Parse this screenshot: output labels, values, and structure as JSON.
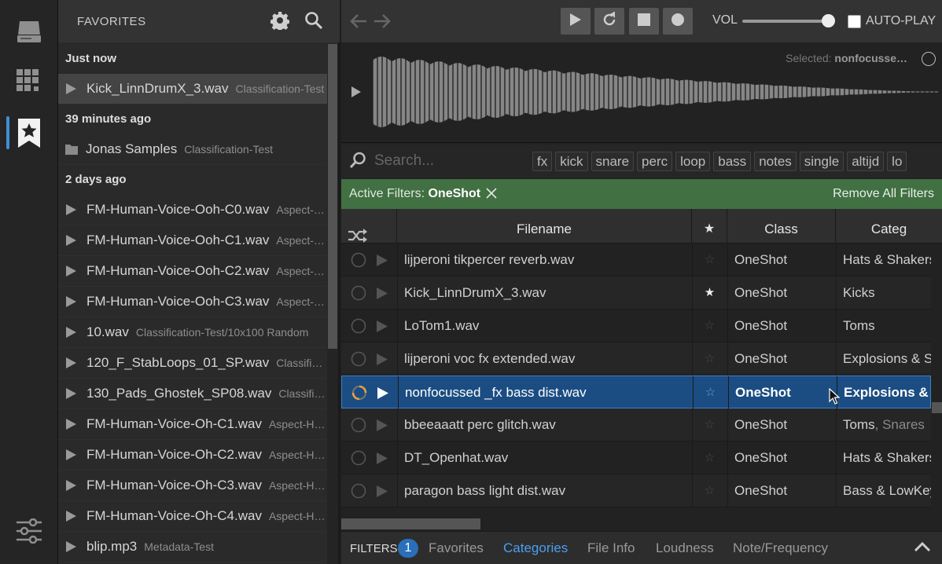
{
  "rail": {
    "items": [
      "drive-icon",
      "grid-icon",
      "star-bookmark-icon",
      "sliders-icon"
    ],
    "active_index": 2,
    "accent": "#3d8fd6"
  },
  "favorites": {
    "title": "FAVORITES",
    "groups": [
      {
        "heading": "Just now",
        "rows": [
          {
            "type": "file",
            "name": "Kick_LinnDrumX_3.wav",
            "sub": "Classification-Test",
            "selected": true
          }
        ]
      },
      {
        "heading": "39 minutes ago",
        "rows": [
          {
            "type": "folder",
            "name": "Jonas Samples",
            "sub": "Classification-Test",
            "selected": false
          }
        ]
      },
      {
        "heading": "2 days ago",
        "rows": [
          {
            "type": "file",
            "name": "FM-Human-Voice-Ooh-C0.wav",
            "sub": "Aspect-Human-Voice",
            "selected": false
          },
          {
            "type": "file",
            "name": "FM-Human-Voice-Ooh-C1.wav",
            "sub": "Aspect-Human-Voice",
            "selected": false
          },
          {
            "type": "file",
            "name": "FM-Human-Voice-Ooh-C2.wav",
            "sub": "Aspect-Human-Voice",
            "selected": false
          },
          {
            "type": "file",
            "name": "FM-Human-Voice-Ooh-C3.wav",
            "sub": "Aspect-Human-Voice",
            "selected": false
          },
          {
            "type": "file",
            "name": "10.wav",
            "sub": "Classification-Test/10x100 Random",
            "selected": false
          },
          {
            "type": "file",
            "name": "120_F_StabLoops_01_SP.wav",
            "sub": "Classification-Test",
            "selected": false
          },
          {
            "type": "file",
            "name": "130_Pads_Ghostek_SP08.wav",
            "sub": "Classification-Test",
            "selected": false
          },
          {
            "type": "file",
            "name": "FM-Human-Voice-Oh-C1.wav",
            "sub": "Aspect-Human-Voice",
            "selected": false
          },
          {
            "type": "file",
            "name": "FM-Human-Voice-Oh-C2.wav",
            "sub": "Aspect-Human-Voice",
            "selected": false
          },
          {
            "type": "file",
            "name": "FM-Human-Voice-Oh-C3.wav",
            "sub": "Aspect-Human-Voice",
            "selected": false
          },
          {
            "type": "file",
            "name": "FM-Human-Voice-Oh-C4.wav",
            "sub": "Aspect-Human-Voice",
            "selected": false
          },
          {
            "type": "file",
            "name": "blip.mp3",
            "sub": "Metadata-Test",
            "selected": false
          }
        ]
      }
    ]
  },
  "toolbar": {
    "vol_label": "VOL",
    "volume": 0.9,
    "autoplay_label": "AUTO-PLAY",
    "autoplay_checked": false
  },
  "waveform": {
    "selected_prefix": "Selected: ",
    "selected_name": "nonfocusse…"
  },
  "search": {
    "placeholder": "Search...",
    "tags": [
      "fx",
      "kick",
      "snare",
      "perc",
      "loop",
      "bass",
      "notes",
      "single",
      "altijd",
      "lo"
    ]
  },
  "filters": {
    "label": "Active Filters: ",
    "value": "OneShot",
    "remove_all": "Remove All Filters",
    "bar_color": "#417042"
  },
  "table": {
    "headers": {
      "filename": "Filename",
      "star": "★",
      "class": "Class",
      "category": "Categ"
    },
    "rows": [
      {
        "filename": "lijperoni tikpercer reverb.wav",
        "starred": false,
        "class": "OneShot",
        "category": "Hats & Shakers",
        "category_sub": "",
        "selected": false,
        "loading": false
      },
      {
        "filename": "Kick_LinnDrumX_3.wav",
        "starred": true,
        "class": "OneShot",
        "category": "Kicks",
        "category_sub": "",
        "selected": false,
        "loading": false
      },
      {
        "filename": "LoTom1.wav",
        "starred": false,
        "class": "OneShot",
        "category": "Toms",
        "category_sub": "",
        "selected": false,
        "loading": false
      },
      {
        "filename": "lijperoni voc fx extended.wav",
        "starred": false,
        "class": "OneShot",
        "category": "Explosions & S",
        "category_sub": "",
        "selected": false,
        "loading": false
      },
      {
        "filename": "nonfocussed _fx bass dist.wav",
        "starred": false,
        "class": "OneShot",
        "category": "Explosions & S",
        "category_sub": "",
        "selected": true,
        "loading": true
      },
      {
        "filename": "bbeeaaatt perc glitch.wav",
        "starred": false,
        "class": "OneShot",
        "category": "Toms",
        "category_sub": ", Snares",
        "selected": false,
        "loading": false
      },
      {
        "filename": "DT_Openhat.wav",
        "starred": false,
        "class": "OneShot",
        "category": "Hats & Shakers",
        "category_sub": "",
        "selected": false,
        "loading": false
      },
      {
        "filename": "paragon bass light dist.wav",
        "starred": false,
        "class": "OneShot",
        "category": "Bass & LowKeys",
        "category_sub": "",
        "selected": false,
        "loading": false
      }
    ],
    "selected_color": "#1b4d82"
  },
  "bottom": {
    "filters_label": "FILTERS",
    "badge": "1",
    "tabs": [
      "Favorites",
      "Categories",
      "File Info",
      "Loudness",
      "Note/Frequency"
    ],
    "active_tab": 1
  }
}
